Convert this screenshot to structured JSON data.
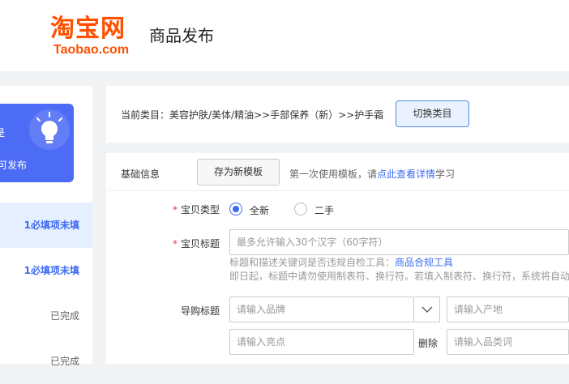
{
  "header": {
    "logo_cn": "淘宝网",
    "logo_en": "Taobao.com",
    "title": "商品发布"
  },
  "sidebar": {
    "promo_text_top": "是",
    "promo_text": "可发布",
    "items": [
      {
        "label": "1必填项未填",
        "state": "active"
      },
      {
        "label": "1必填项未填",
        "state": "todo"
      },
      {
        "label": "已完成",
        "state": "done"
      },
      {
        "label": "已完成",
        "state": "done"
      }
    ]
  },
  "category": {
    "text": "当前类目：美容护肤/美体/精油>>手部保养（新）>>护手霜",
    "switch_label": "切换类目"
  },
  "base": {
    "label": "基础信息",
    "template_button": "存为新模板",
    "hint_prefix": "第一次使用模板，请",
    "hint_link": "点此查看详情",
    "hint_suffix": "学习"
  },
  "form": {
    "type_label": "宝贝类型",
    "type_options": [
      {
        "label": "全新",
        "checked": true
      },
      {
        "label": "二手",
        "checked": false
      }
    ],
    "title_label": "宝贝标题",
    "title_placeholder": "最多允许输入30个汉字（60字符）",
    "title_hint_prefix": "标题和描述关键词是否违规自检工具：",
    "title_hint_link": "商品合规工具",
    "title_hint2": "即日起，标题中请勿使用制表符、换行符。若填入制表符、换行符，系统将自动",
    "guide_label": "导购标题",
    "brand_placeholder": "请输入品牌",
    "origin_placeholder": "请输入产地",
    "highlight_placeholder": "请输入亮点",
    "delete_label": "删除",
    "category_word_placeholder": "请输入品类词"
  },
  "colors": {
    "brand": "#ff5000",
    "accent": "#3d6bf2",
    "required": "#e4393c"
  }
}
